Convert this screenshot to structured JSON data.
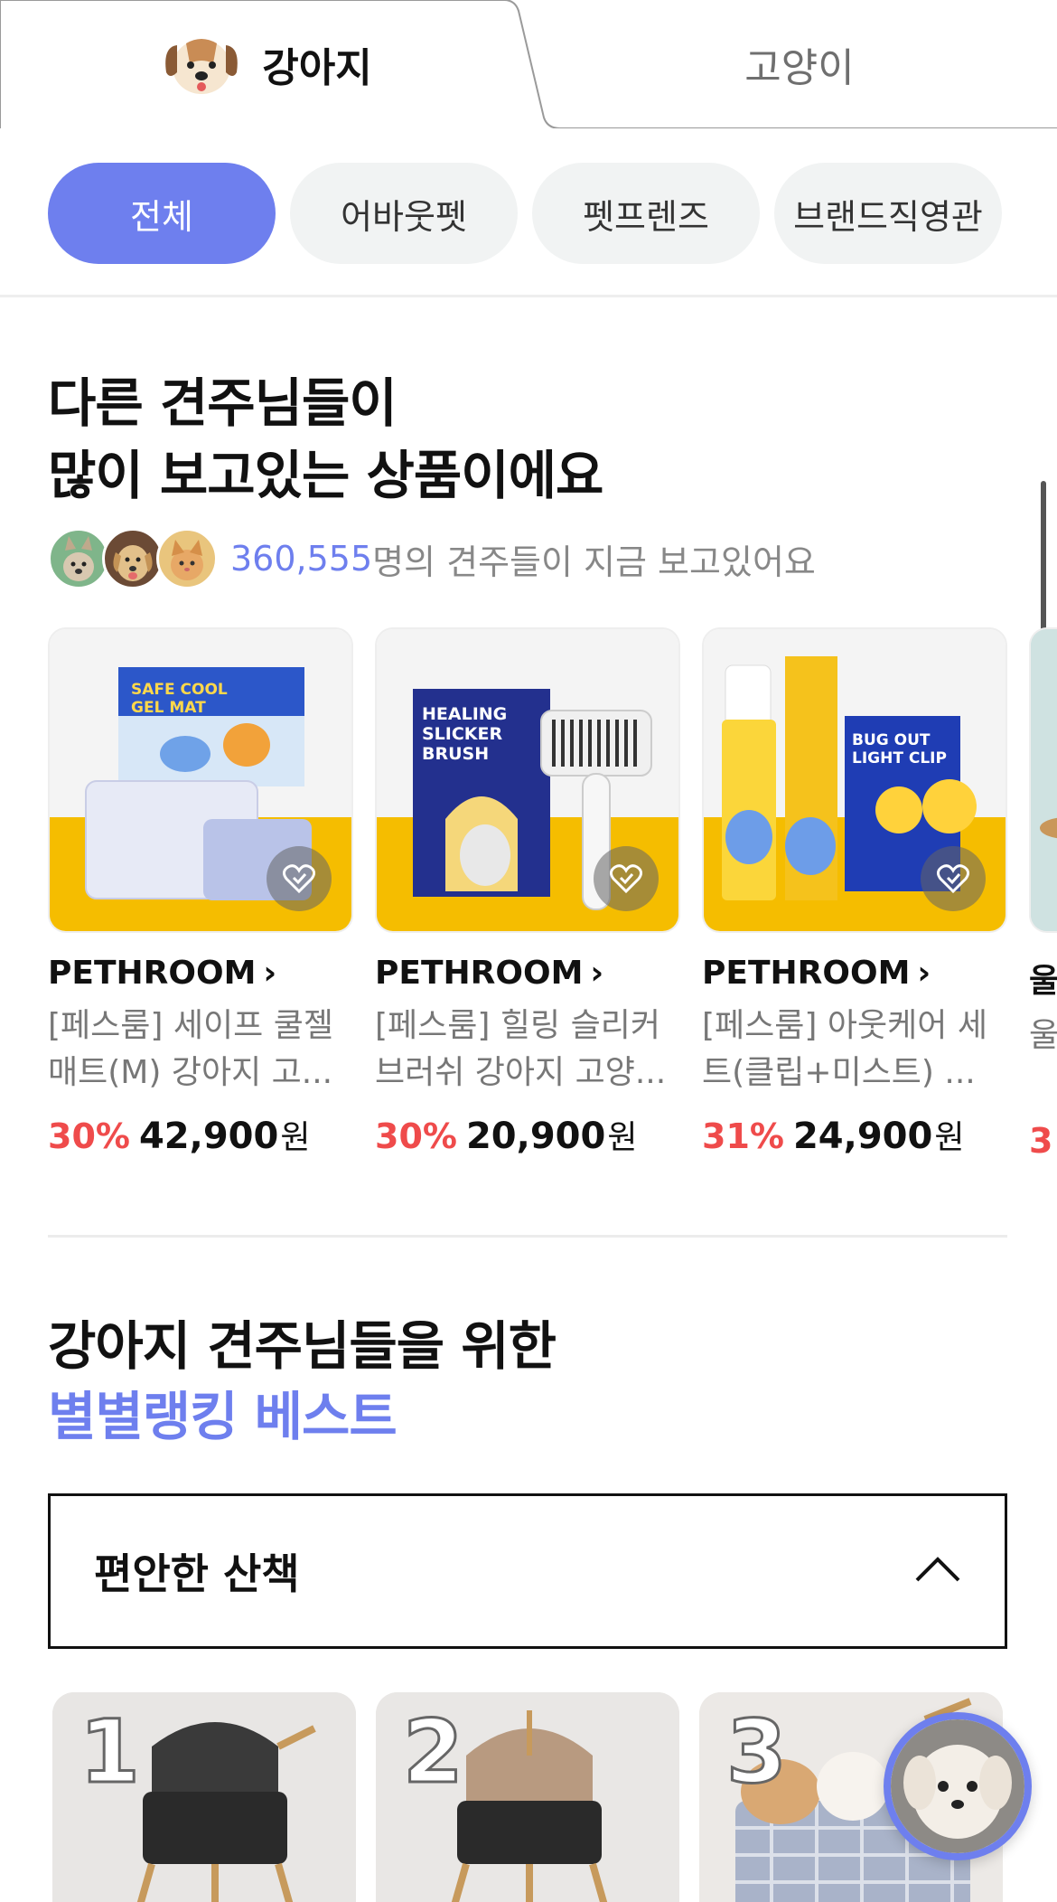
{
  "animal_tabs": {
    "dog": {
      "label": "강아지",
      "icon": "dog-face-icon"
    },
    "cat": {
      "label": "고양이"
    }
  },
  "chips": [
    {
      "label": "전체",
      "active": true
    },
    {
      "label": "어바웃펫",
      "active": false
    },
    {
      "label": "펫프렌즈",
      "active": false
    },
    {
      "label": "브랜드직영관",
      "active": false
    }
  ],
  "popular": {
    "title_line1": "다른 견주님들이",
    "title_line2": "많이 보고있는 상품이에요",
    "viewer_count": "360,555",
    "viewer_suffix": "명의 견주들이 지금 보고있어요",
    "products": [
      {
        "brand": "PETHROOM",
        "name": "[페스룸] 세이프 쿨젤 매트(M) 강아지 고...",
        "discount": "30%",
        "price": "42,900",
        "currency": "원",
        "package_text": [
          "SAFE COOL",
          "GEL MAT"
        ]
      },
      {
        "brand": "PETHROOM",
        "name": "[페스룸] 힐링 슬리커 브러쉬 강아지 고양...",
        "discount": "30%",
        "price": "20,900",
        "currency": "원",
        "package_text": [
          "HEALING",
          "SLICKER",
          "BRUSH"
        ]
      },
      {
        "brand": "PETHROOM",
        "name": "[페스룸] 아웃케어 세트(클립+미스트) ...",
        "discount": "31%",
        "price": "24,900",
        "currency": "원",
        "package_text": [
          "BUG OUT",
          "LIGHT CLIP"
        ]
      },
      {
        "brand": "울",
        "name": "울양",
        "discount": "3",
        "price": "",
        "currency": "",
        "package_text": []
      }
    ]
  },
  "ranking": {
    "title_line1": "강아지 견주님들을 위한",
    "title_line2": "별별랭킹 베스트",
    "dropdown_value": "편안한 산책",
    "items": [
      {
        "rank": "1"
      },
      {
        "rank": "2"
      },
      {
        "rank": "3"
      }
    ]
  },
  "colors": {
    "accent": "#6e7fee",
    "discount": "#ef4b4b",
    "product_band": "#f5bd00"
  }
}
